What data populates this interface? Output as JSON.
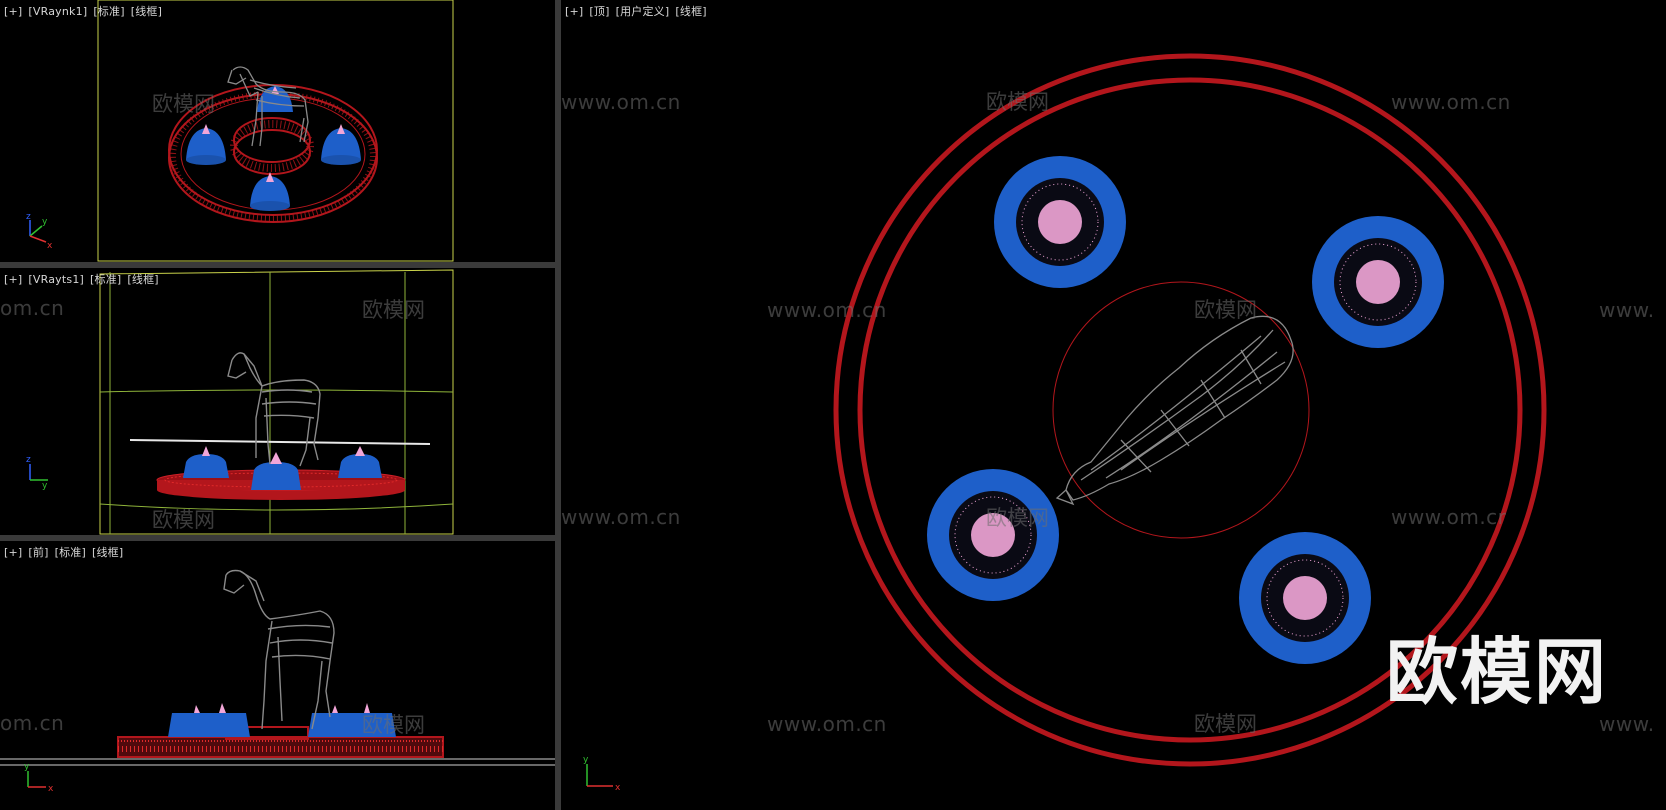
{
  "viewports": {
    "cam1": {
      "parts": [
        "[+]",
        "[VRaynk1]",
        "[标准]",
        "[线框]"
      ]
    },
    "cam2": {
      "parts": [
        "[+]",
        "[VRayts1]",
        "[标准]",
        "[线框]"
      ]
    },
    "front": {
      "parts": [
        "[+]",
        "[前]",
        "[标准]",
        "[线框]"
      ]
    },
    "top": {
      "parts": [
        "[+]",
        "[顶]",
        "[用户定义]",
        "[线框]"
      ]
    }
  },
  "watermarks": {
    "site": "www.om.cn",
    "site_partial": "om.cn",
    "site_cut": "www.",
    "site_cut2": "www.om.cr",
    "brand_cn": "欧模网"
  },
  "brand_logo": "欧模网",
  "colors": {
    "ring": "#b3161c",
    "fountain_blue": "#1e5fc9",
    "fountain_pink": "#f2a6d8",
    "wireframe": "#8a8a8a",
    "camera_frame": "#c9d24a",
    "axis_x": "#e03030",
    "axis_y": "#30c030",
    "axis_z": "#3060ff"
  },
  "axis_labels": {
    "x": "x",
    "y": "y",
    "z": "z"
  }
}
